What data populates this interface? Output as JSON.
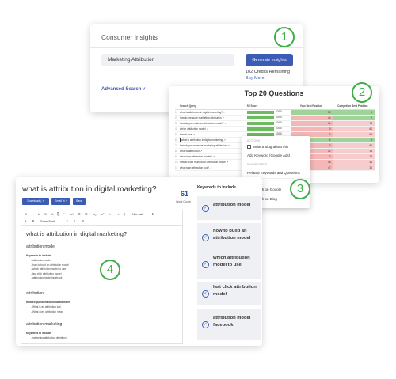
{
  "consumer_insights": {
    "title": "Consumer Insights",
    "topic_value": "Marketing Attribution",
    "generate_label": "Generate Insights",
    "credits": "102 Credits Remaining",
    "buy_more": "Buy More",
    "advanced_search": "Advanced Search ˅",
    "step": "1"
  },
  "top_questions": {
    "title": "Top 20 Questions",
    "step": "2",
    "columns": [
      "Search Query",
      "SJ Score",
      "Your Best Position",
      "Competitor Best Position"
    ],
    "rows": [
      {
        "n": "1",
        "q": "what is attribution in digital marketing? ↗",
        "score": "100.0",
        "your": "10",
        "comp": "5"
      },
      {
        "n": "2",
        "q": "how to measure marketing attribution ↗",
        "score": "100.0",
        "your": "44",
        "comp": "7"
      },
      {
        "n": "3",
        "q": "how do you make an attribution model? ↗",
        "score": "100.0",
        "your": "74",
        "comp": "74"
      },
      {
        "n": "4",
        "q": "which attribution model ↗",
        "score": "100.0",
        "your": "0",
        "comp": "60"
      },
      {
        "n": "5",
        "q": "how to use ↗",
        "score": "100.0",
        "your": "0",
        "comp": "55"
      },
      {
        "n": "6",
        "q": "what is attribution in digital marketing ↗",
        "score": "100.0",
        "your": "4",
        "comp": "4"
      },
      {
        "n": "7",
        "q": "how do you measure marketing attribution ↗",
        "score": "100.0",
        "your": "0",
        "comp": "60"
      },
      {
        "n": "8",
        "q": "what is attribution ↗",
        "score": "100.0",
        "your": "42",
        "comp": "16"
      },
      {
        "n": "9",
        "q": "what is an attribution model? ↗",
        "score": "100.0",
        "your": "0",
        "comp": "74"
      },
      {
        "n": "10",
        "q": "how to build multi touch attribution model ↗",
        "score": "100.0",
        "your": "48",
        "comp": "44"
      },
      {
        "n": "11",
        "q": "what is an attribution tool? ↗",
        "score": "100.0",
        "your": "47",
        "comp": "30"
      }
    ]
  },
  "context_menu": {
    "actions_label": "ACTIONS",
    "write_blog": "Write a Blog about this",
    "add_keyword": "Add Keyword (Google Ads)",
    "dashboards_label": "DASHBOARDS",
    "related": "Related Keywords and Questions",
    "links_label": "LINKS",
    "search_google": "Search on Google",
    "search_bing": "Search on Bing",
    "step": "3"
  },
  "editor": {
    "title": "what is attribution in digital marketing?",
    "word_count": "61",
    "word_count_label": "Word Count",
    "download": "Download ⤓ ˅",
    "email": "Email ✉ ˅",
    "save": "Save",
    "toolbar_row1": [
      "B",
      "I",
      "U",
      "S",
      "%",
      "⎘",
      "\"",
      "</>",
      "☰",
      "☷",
      "x₂",
      "x²",
      "⇤",
      "⇥",
      "¶",
      "Normal",
      "⇕"
    ],
    "toolbar_row2": [
      "A",
      "⊞",
      "Sans Serif",
      "⇕",
      "≡",
      "T̸"
    ],
    "step": "4",
    "doc": {
      "h1": "what is attribution in digital marketing?",
      "h2_1": "attribution model",
      "kw_label": "Keywords to include:",
      "kw_list_1": [
        "- attribution model",
        "- how to build an attribution model",
        "- which attribution model to use",
        "- last click attribution model",
        "- attribution model facebook"
      ],
      "h2_2": "attribution",
      "rq_label": "Related questions to include/answer:",
      "rq_list": [
        "- What is an attribution tool",
        "- What does attribution mean"
      ],
      "h2_3": "attribution marketing",
      "kw_label_2": "Keywords to include:",
      "kw_list_2": [
        "- marketing attribution definition"
      ]
    },
    "keywords_title": "Keywords to Include",
    "keywords": [
      "attribution model",
      "how to build an attribution model",
      "which attribution model to use",
      "last click attribution model",
      "attribution model facebook"
    ]
  }
}
